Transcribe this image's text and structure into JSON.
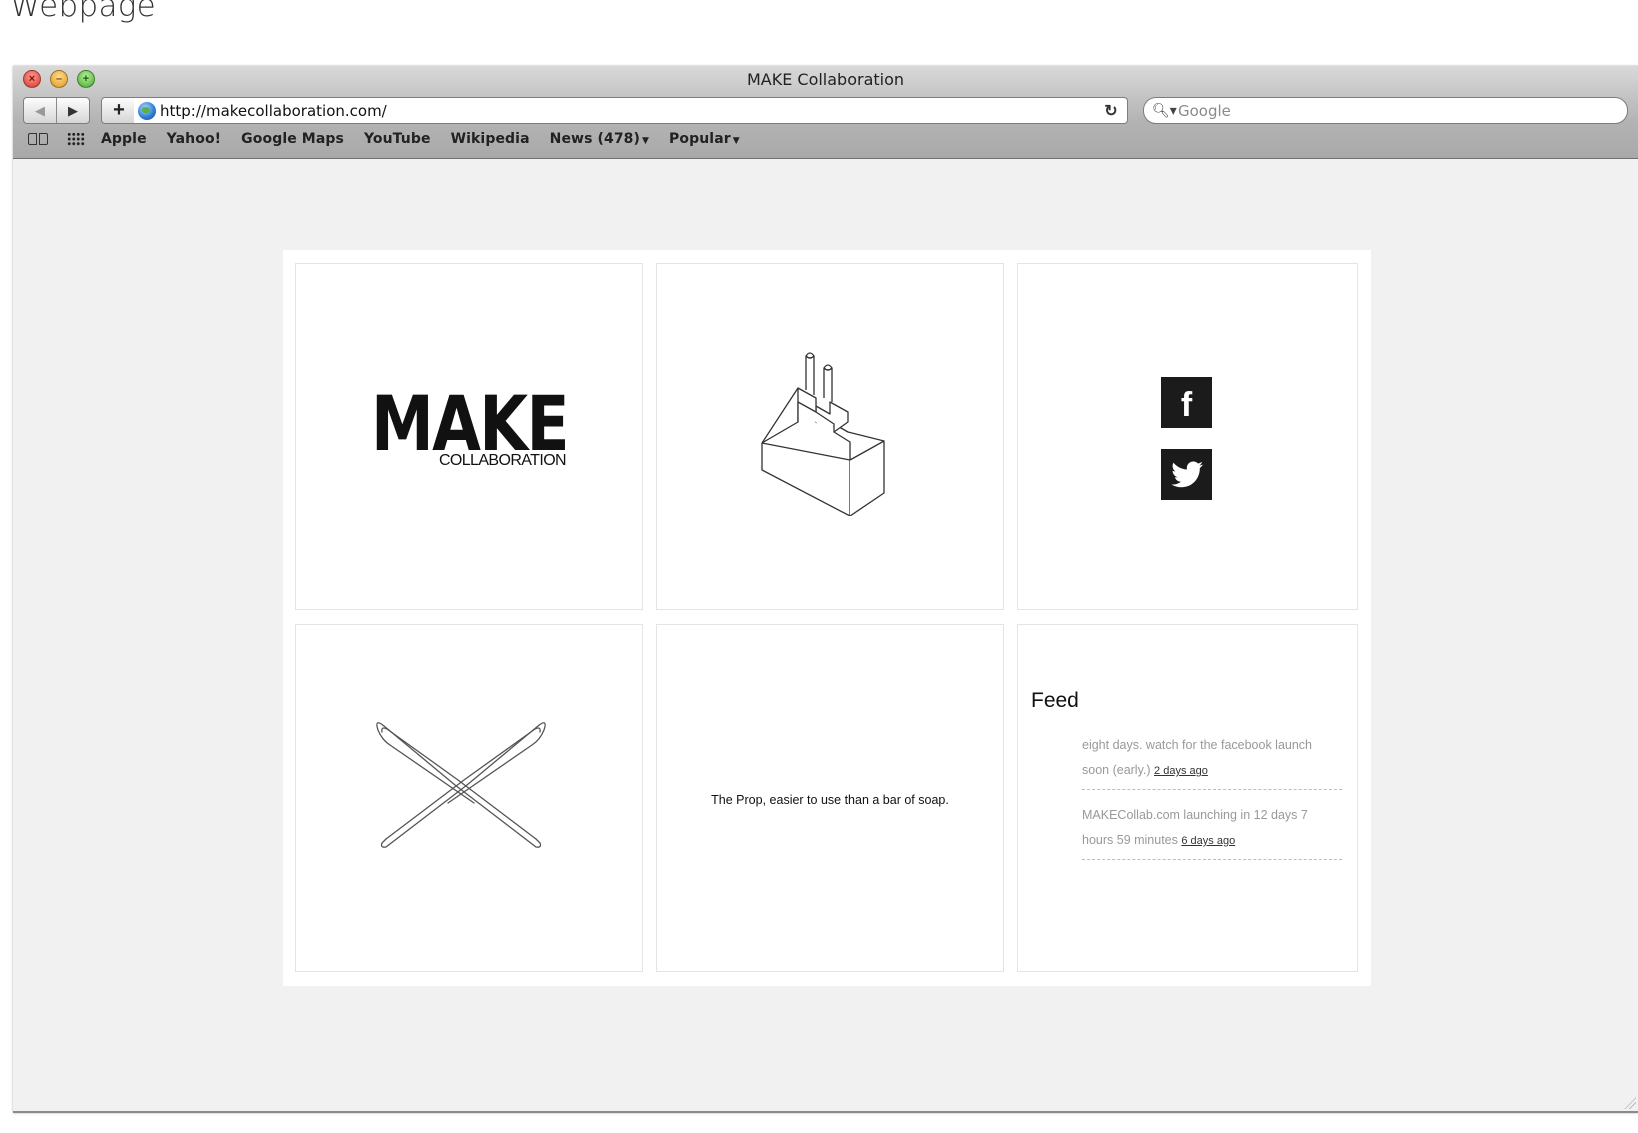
{
  "page_heading": "Webpage",
  "window": {
    "title": "MAKE Collaboration",
    "url": "http://makecollaboration.com/",
    "search_placeholder": "Google"
  },
  "bookmarks": [
    {
      "label": "Apple"
    },
    {
      "label": "Yahoo!"
    },
    {
      "label": "Google Maps"
    },
    {
      "label": "YouTube"
    },
    {
      "label": "Wikipedia"
    },
    {
      "label": "News (478)"
    },
    {
      "label": "Popular"
    }
  ],
  "icons": {
    "back": "back-arrow-icon",
    "forward": "forward-arrow-icon",
    "add": "plus-icon",
    "site": "globe-icon",
    "reload": "reload-icon",
    "search": "magnifier-icon",
    "bookmarks_book": "book-icon",
    "top_sites": "grid-icon"
  },
  "site": {
    "logo_main": "MAKE",
    "logo_sub": "COLLABORATION",
    "prop_text": "The Prop, easier to use than a bar of soap.",
    "feed": {
      "title": "Feed",
      "items": [
        {
          "text": "eight days. watch for the facebook launch soon (early.)",
          "time": "2 days ago"
        },
        {
          "text": "MAKECollab.com launching in 12 days 7 hours 59 minutes",
          "time": "6 days ago"
        }
      ]
    }
  },
  "colors": {
    "page_bg": "#f1f1f1",
    "tile_border": "#e4e4e4",
    "social_bg": "#1b1b1b",
    "feed_text": "#999999"
  }
}
